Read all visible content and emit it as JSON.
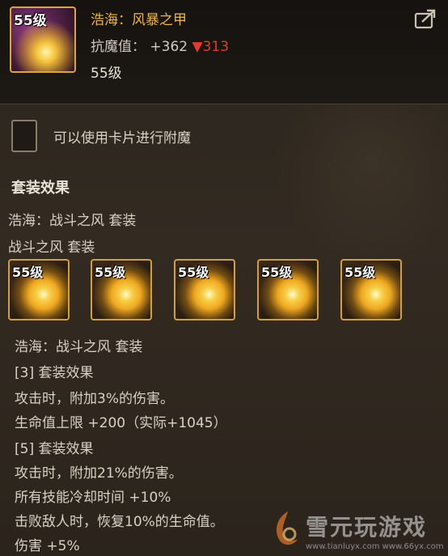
{
  "item": {
    "level_tag": "55级",
    "name": "浩海：风暴之甲",
    "stat_label": "抗魔值：",
    "stat_value": "+362",
    "stat_diff": "▼313",
    "level": "55级"
  },
  "card": {
    "text": "可以使用卡片进行附魔"
  },
  "set": {
    "section_title": "套装效果",
    "set_name": "浩海：战斗之风 套装",
    "subset_name": "战斗之风 套装",
    "slots": [
      {
        "level": "55级"
      },
      {
        "level": "55级"
      },
      {
        "level": "55级"
      },
      {
        "level": "55级"
      },
      {
        "level": "55级"
      }
    ],
    "detail_name": "浩海：战斗之风 套装",
    "effect3_title": "[3] 套装效果",
    "effect3_lines": [
      "攻击时，附加3%的伤害。",
      "生命值上限 +200（实际+1045）"
    ],
    "effect5_title": "[5] 套装效果",
    "effect5_lines": [
      "攻击时，附加21%的伤害。",
      "所有技能冷却时间 +10%",
      "击败敌人时，恢复10%的生命值。",
      "伤害 +5%"
    ]
  },
  "watermark": {
    "text": "雪元玩游戏",
    "url": "www.tianluyx.com  www.66yx.com"
  },
  "colors": {
    "title": "#f0b540",
    "decrease": "#e23a2e",
    "frame_gold": "#d4a033"
  },
  "icons": {
    "share": "share-icon",
    "card_slot": "card-slot-icon"
  }
}
